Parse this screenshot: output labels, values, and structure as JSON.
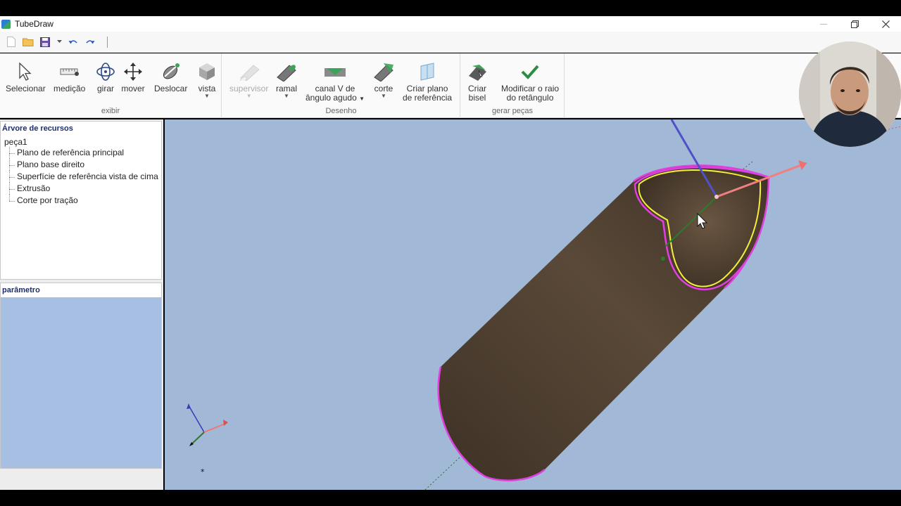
{
  "app": {
    "title": "TubeDraw",
    "window_controls": [
      "minimize",
      "restore",
      "close"
    ]
  },
  "quick_access": {
    "icons": [
      "new-file-icon",
      "open-folder-icon",
      "save-icon",
      "dropdown-icon",
      "undo-icon",
      "redo-icon"
    ]
  },
  "ribbon": {
    "groups": [
      {
        "label": "exibir",
        "tools": [
          {
            "label": "Selecionar",
            "icon": "pointer-icon"
          },
          {
            "label": "medição",
            "icon": "ruler-icon"
          },
          {
            "label": "girar",
            "icon": "rotate-icon"
          },
          {
            "label": "mover",
            "icon": "move-icon"
          },
          {
            "label": "Deslocar",
            "icon": "shift-icon"
          },
          {
            "label": "vista",
            "icon": "cube-icon"
          }
        ]
      },
      {
        "label": "Desenho",
        "tools": [
          {
            "label": "supervisor",
            "icon": "tube-icon",
            "disabled": true
          },
          {
            "label": "ramal",
            "icon": "branch-icon"
          },
          {
            "label1": "canal V de",
            "label2": "ângulo agudo",
            "icon": "v-channel-icon"
          },
          {
            "label": "corte",
            "icon": "cut-icon"
          },
          {
            "label1": "Criar plano",
            "label2": "de referência",
            "icon": "plane-icon"
          }
        ]
      },
      {
        "label": "gerar peças",
        "tools": [
          {
            "label1": "Criar",
            "label2": "bisel",
            "icon": "bevel-icon"
          },
          {
            "label1": "Modificar o raio",
            "label2": "do retângulo",
            "icon": "checkmark-icon"
          }
        ]
      }
    ]
  },
  "feature_tree": {
    "title": "Árvore de recursos",
    "root": "peça1",
    "items": [
      "Plano de referência principal",
      "Plano base direito",
      "Superfície de referência vista de cima",
      "Extrusão",
      "Corte por tração"
    ]
  },
  "parameters": {
    "title": "parâmetro"
  },
  "colors": {
    "viewport_bg": "#a1b8d6",
    "tube_body": "#4e3f31",
    "outline_magenta": "#e040e0",
    "outline_yellow": "#f2ee3a",
    "axis_x": "#f07878",
    "axis_y": "#2d7a2d",
    "axis_z": "#3a3ab8"
  }
}
